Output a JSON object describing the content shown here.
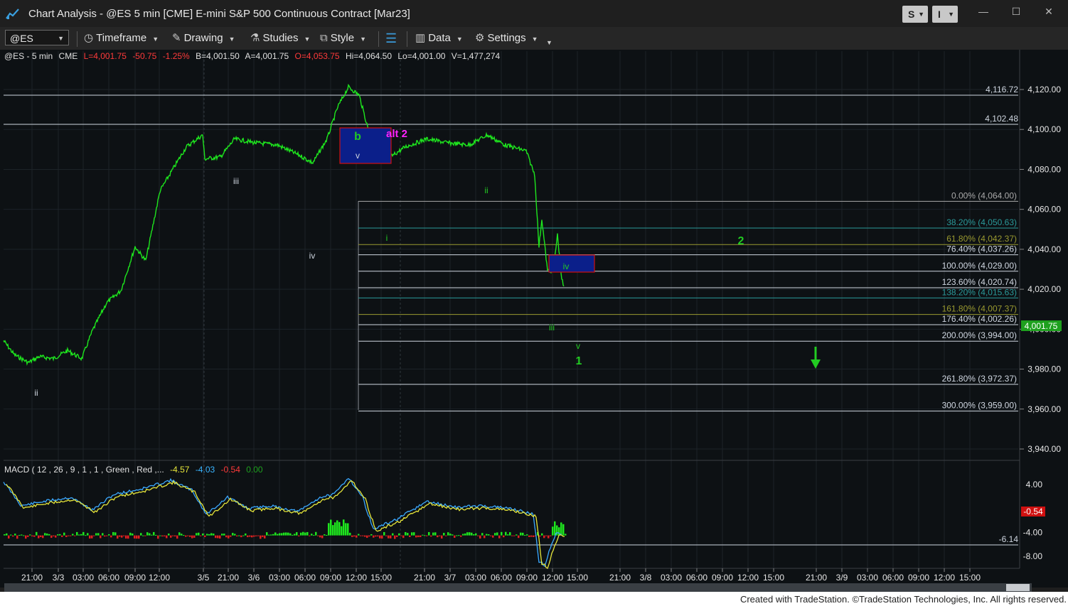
{
  "window": {
    "title": "Chart Analysis - @ES 5 min [CME] E-mini S&P 500 Continuous Contract [Mar23]",
    "badge_s": "S",
    "badge_i": "I",
    "minimize": "—",
    "maximize": "☐",
    "close": "✕"
  },
  "toolbar": {
    "symbol": "@ES",
    "timeframe": "Timeframe",
    "drawing": "Drawing",
    "studies": "Studies",
    "style": "Style",
    "data": "Data",
    "settings": "Settings"
  },
  "infobar": {
    "symbol": "@ES - 5 min",
    "exchange": "CME",
    "last": "L=4,001.75",
    "change": "-50.75",
    "pct": "-1.25%",
    "bid": "B=4,001.50",
    "ask": "A=4,001.75",
    "open": "O=4,053.75",
    "high": "Hi=4,064.50",
    "low": "Lo=4,001.00",
    "volume": "V=1,477,274"
  },
  "colors": {
    "price_line": "#1ee61e",
    "up": "#1ee61e",
    "down": "#e02020",
    "fib_blue": "#8fa8c8",
    "fib_teal": "#2aa0a0",
    "fib_olive": "#9a9a30",
    "magenta": "#ff22ff",
    "green_label": "#22cc22",
    "box_fill": "#0b1f8a",
    "box_border": "#d01010"
  },
  "price_axis": {
    "ticks": [
      "4,120.00",
      "4,100.00",
      "4,080.00",
      "4,060.00",
      "4,040.00",
      "4,020.00",
      "4,000.00",
      "3,980.00",
      "3,960.00",
      "3,940.00"
    ],
    "current": "4,001.75"
  },
  "hlines": [
    "4,116.72",
    "4,102.48"
  ],
  "fibs": [
    {
      "label": "0.00% (4,064.00)",
      "color": "#a9a9a9"
    },
    {
      "label": "38.20% (4,050.63)",
      "color": "#2a9a9a"
    },
    {
      "label": "61.80% (4,042.37)",
      "color": "#9a9a30"
    },
    {
      "label": "76.40% (4,037.26)",
      "color": "#cfd6e0"
    },
    {
      "label": "100.00% (4,029.00)",
      "color": "#cfd6e0"
    },
    {
      "label": "123.60% (4,020.74)",
      "color": "#cfd6e0"
    },
    {
      "label": "138.20% (4,015.63)",
      "color": "#2a9a9a"
    },
    {
      "label": "161.80% (4,007.37)",
      "color": "#9a9a30"
    },
    {
      "label": "176.40% (4,002.26)",
      "color": "#cfd6e0"
    },
    {
      "label": "200.00% (3,994.00)",
      "color": "#cfd6e0"
    },
    {
      "label": "261.80% (3,972.37)",
      "color": "#cfd6e0"
    },
    {
      "label": "300.00% (3,959.00)",
      "color": "#cfd6e0"
    }
  ],
  "wave_labels": {
    "ii_left": "ii",
    "iii_left": "iii",
    "iv_left": "iv",
    "b": "b",
    "v_top": "v",
    "alt2": "alt 2",
    "i_mid": "i",
    "ii_mid": "ii",
    "iii_low": "iii",
    "iv_box": "iv",
    "v_low": "v",
    "one": "1",
    "two": "2"
  },
  "macd": {
    "name": "MACD ( 12 , 26 , 9 , 1 , 1 , Green , Red ,...",
    "v1": "-4.57",
    "v2": "-4.03",
    "v3": "-0.54",
    "v4": "0.00",
    "axis": [
      "4.00",
      "-4.00",
      "-8.00"
    ],
    "current": "-0.54",
    "level": "-6.14"
  },
  "time_axis": [
    "21:00",
    "3/3",
    "03:00",
    "06:00",
    "09:00",
    "12:00",
    "3/5",
    "21:00",
    "3/6",
    "03:00",
    "06:00",
    "09:00",
    "12:00",
    "15:00",
    "21:00",
    "3/7",
    "03:00",
    "06:00",
    "09:00",
    "12:00",
    "15:00",
    "21:00",
    "3/8",
    "03:00",
    "06:00",
    "09:00",
    "12:00",
    "15:00",
    "21:00",
    "3/9",
    "03:00",
    "06:00",
    "09:00",
    "12:00",
    "15:00"
  ],
  "footer": "Created with TradeStation. ©TradeStation Technologies, Inc. All rights reserved."
}
